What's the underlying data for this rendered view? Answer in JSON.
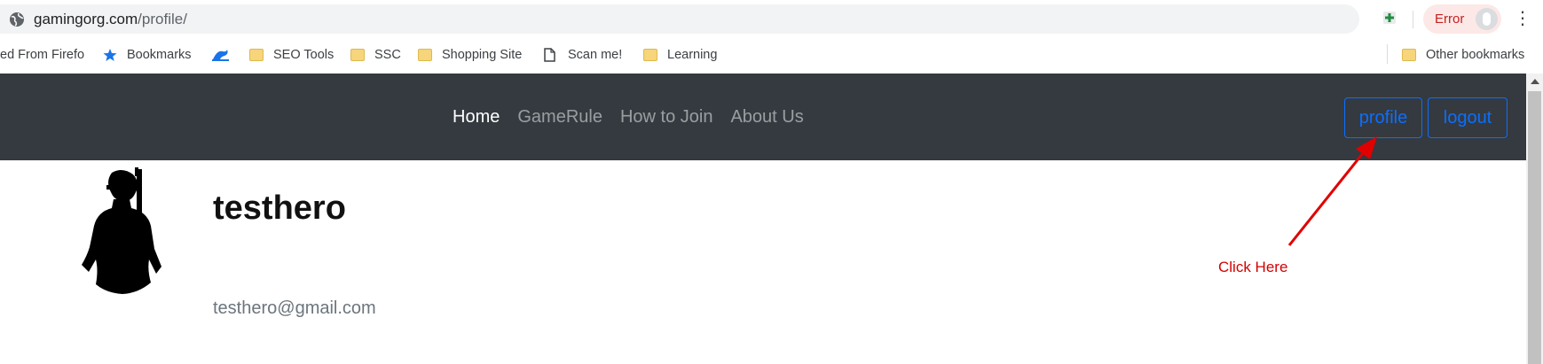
{
  "browser": {
    "url_host": "gamingorg.com",
    "url_path": "/profile/",
    "profile_status": "Error",
    "menu_glyph": "⋮"
  },
  "bookmarks": {
    "items": [
      {
        "label": "ed From Firefo",
        "icon": "none"
      },
      {
        "label": "Bookmarks",
        "icon": "star-icon"
      },
      {
        "label": "",
        "icon": "wave-icon"
      },
      {
        "label": "SEO Tools",
        "icon": "folder-icon"
      },
      {
        "label": "SSC",
        "icon": "folder-icon"
      },
      {
        "label": "Shopping Site",
        "icon": "folder-icon"
      },
      {
        "label": "Scan me!",
        "icon": "page-icon"
      },
      {
        "label": "Learning",
        "icon": "folder-icon"
      }
    ],
    "other": "Other bookmarks"
  },
  "navbar": {
    "links": [
      "Home",
      "GameRule",
      "How to Join",
      "About Us"
    ],
    "profile_button": "profile",
    "logout_button": "logout",
    "bg_color": "#343a40",
    "accent_color": "#0d6efd"
  },
  "profile": {
    "username": "testhero",
    "email": "testhero@gmail.com",
    "avatar_icon": "soldier-silhouette-icon"
  },
  "annotation": {
    "text": "Click Here",
    "color": "#d40000"
  }
}
